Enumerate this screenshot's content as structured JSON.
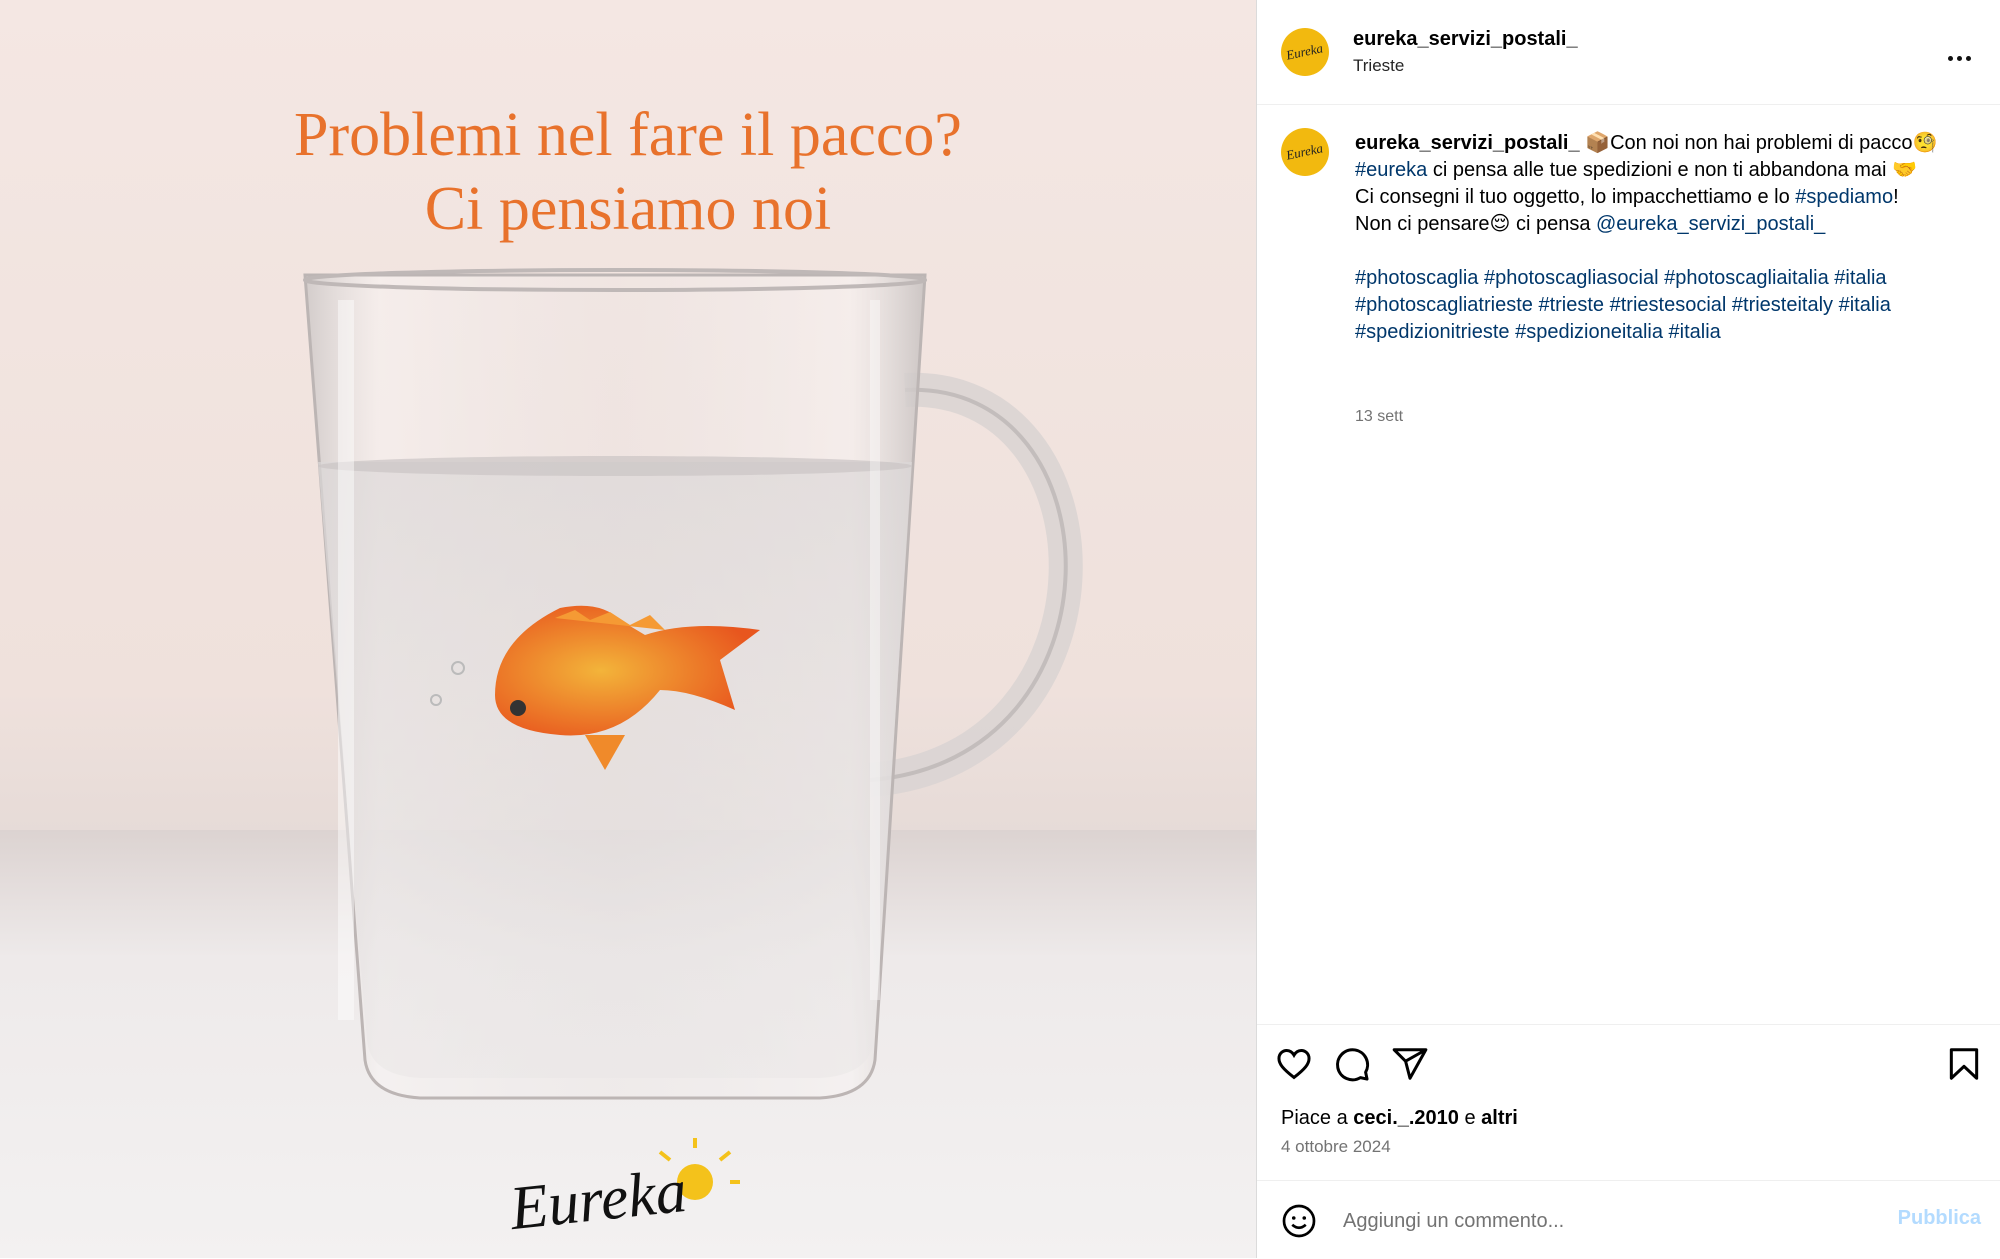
{
  "media": {
    "headline_line1": "Problemi nel fare il pacco?",
    "headline_line2": "Ci pensiamo noi",
    "logo_text": "Eureka"
  },
  "header": {
    "username": "eureka_servizi_postali_",
    "location": "Trieste",
    "avatar_text": "Eureka"
  },
  "caption": {
    "username": "eureka_servizi_postali_",
    "line1_emoji": "📦",
    "line1_text": "Con noi non hai problemi di pacco",
    "line1_end_emoji": "🧐",
    "line2_tag": "#eureka",
    "line2_text": " ci pensa alle tue spedizioni e non ti abbandona mai ",
    "line2_emoji": "🤝",
    "line3_text": "Ci consegni il tuo oggetto, lo impacchettiamo e lo ",
    "line3_tag": "#spediamo",
    "line3_end": "!",
    "line4_text": "Non ci pensare",
    "line4_emoji": "😌",
    "line4_text2": " ci pensa ",
    "line4_mention": "@eureka_servizi_postali_",
    "hashtags": [
      "#photoscaglia",
      "#photoscagliasocial",
      "#photoscagliaitalia",
      "#italia",
      "#photoscagliatrieste",
      "#trieste",
      "#triestesocial",
      "#triesteitaly",
      "#italia",
      "#spedizionitrieste",
      "#spedizioneitalia",
      "#italia"
    ],
    "time_ago": "13 sett"
  },
  "actions": {
    "likes_prefix": "Piace a ",
    "likes_user": "ceci._.2010",
    "likes_middle": " e ",
    "likes_others": "altri",
    "date": "4 ottobre 2024"
  },
  "comment": {
    "placeholder": "Aggiungi un commento...",
    "publish_label": "Pubblica"
  },
  "colors": {
    "link": "#00376b",
    "headline": "#e8722c",
    "avatar_bg": "#f2b90f",
    "publish_disabled": "#b3dbff"
  }
}
